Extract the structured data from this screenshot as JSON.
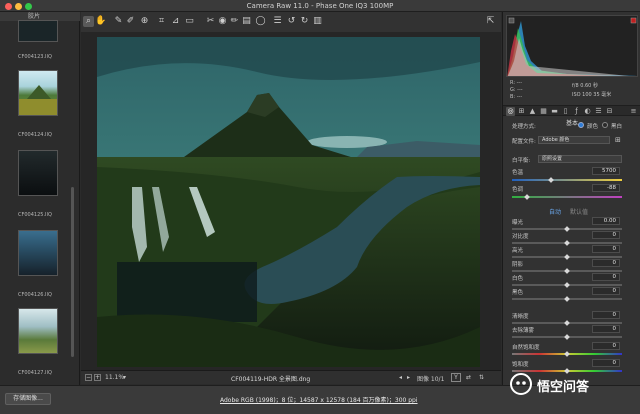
{
  "window": {
    "title": "Camera Raw 11.0  -  Phase One IQ3 100MP"
  },
  "filmstrip": {
    "header": "胶片",
    "items": [
      {
        "label": "CF004123.IIQ"
      },
      {
        "label": "CF004124.IIQ"
      },
      {
        "label": "CF004125.IIQ"
      },
      {
        "label": "CF004126.IIQ"
      },
      {
        "label": "CF004127.IIQ"
      }
    ]
  },
  "toolbar": {
    "tools": [
      "zoom-icon",
      "hand-icon",
      "white-balance-icon",
      "color-sampler-icon",
      "target-adjust-icon",
      "crop-icon",
      "straighten-icon",
      "transform-icon",
      "spot-removal-icon",
      "red-eye-icon",
      "adjustment-brush-icon",
      "graduated-filter-icon",
      "radial-filter-icon",
      "preferences-icon",
      "rotate-ccw-icon",
      "rotate-cw-icon",
      "trash-icon"
    ],
    "fullscreen_icon": "fullscreen-icon"
  },
  "bottombar": {
    "zoom": "11.1%",
    "filename": "CF004119-HDR 全景图.dng",
    "image_counter": "图像 10/1",
    "view_mode": "Y"
  },
  "statusbar": {
    "save_label": "存储图像...",
    "workflow": "Adobe RGB (1998)；8 位；14587 x 12578 (184 百万像素)；300 ppi"
  },
  "watermark": {
    "text": "悟空问答"
  },
  "readout": {
    "r": "R:  ---",
    "g": "G:  ---",
    "b": "B:  ---",
    "exposure": "f/8    0.60 秒",
    "iso": "ISO 100    35 毫米"
  },
  "panel": {
    "section_title": "基本",
    "treatment_label": "处理方式:",
    "treatment_color": "颜色",
    "treatment_bw": "黑白",
    "profile_label": "配置文件:",
    "profile_value": "Adobe 颜色",
    "wb_label": "白平衡:",
    "wb_value": "原照设置",
    "auto_label": "自动",
    "default_label": "默认值",
    "sliders": [
      {
        "name": "色温",
        "value": "5700"
      },
      {
        "name": "色调",
        "value": "-88"
      },
      {
        "name": "曝光",
        "value": "0.00"
      },
      {
        "name": "对比度",
        "value": "0"
      },
      {
        "name": "高光",
        "value": "0"
      },
      {
        "name": "阴影",
        "value": "0"
      },
      {
        "name": "白色",
        "value": "0"
      },
      {
        "name": "黑色",
        "value": "0"
      },
      {
        "name": "清晰度",
        "value": "0"
      },
      {
        "name": "去除薄雾",
        "value": "0"
      },
      {
        "name": "自然饱和度",
        "value": "0"
      },
      {
        "name": "饱和度",
        "value": "0"
      }
    ]
  },
  "colors": {
    "accent": "#2e7cd6",
    "photo_sky": "#2a5a5e",
    "photo_ground": "#1f3a1c"
  }
}
